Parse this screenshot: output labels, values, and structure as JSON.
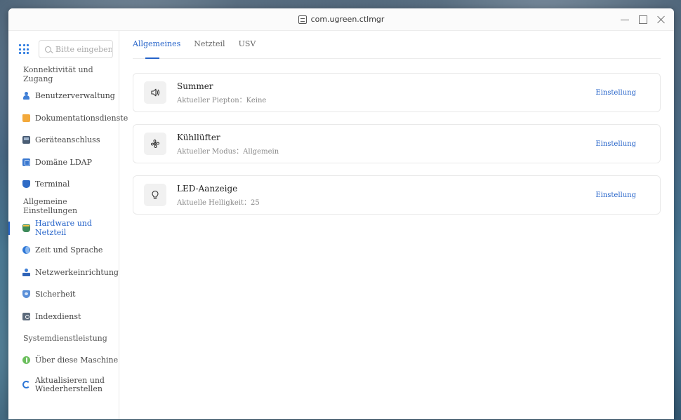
{
  "window": {
    "title": "com.ugreen.ctlmgr"
  },
  "search": {
    "placeholder": "Bitte eingeben"
  },
  "sidebar": {
    "groups": [
      {
        "label": "Konnektivität und Zugang",
        "items": [
          {
            "label": "Benutzerverwaltung",
            "icon": "user-icon"
          },
          {
            "label": "Dokumentationsdienste",
            "icon": "folder-icon"
          },
          {
            "label": "Geräteanschluss",
            "icon": "device-icon"
          },
          {
            "label": "Domäne LDAP",
            "icon": "domain-icon"
          },
          {
            "label": "Terminal",
            "icon": "terminal-icon"
          }
        ]
      },
      {
        "label": "Allgemeine Einstellungen",
        "items": [
          {
            "label": "Hardware und Netzteil",
            "icon": "hardware-icon",
            "active": true
          },
          {
            "label": "Zeit und Sprache",
            "icon": "globe-icon"
          },
          {
            "label": "Netzwerkeinrichtung",
            "icon": "network-icon"
          },
          {
            "label": "Sicherheit",
            "icon": "shield-icon"
          },
          {
            "label": "Indexdienst",
            "icon": "index-icon"
          }
        ]
      },
      {
        "label": "Systemdienstleistung",
        "items": [
          {
            "label": "Über diese Maschine",
            "icon": "info-icon"
          },
          {
            "label_line1": "Aktualisieren und",
            "label_line2": "Wiederherstellen",
            "icon": "refresh-icon"
          }
        ]
      }
    ]
  },
  "tabs": [
    {
      "label": "Allgemeines",
      "active": true
    },
    {
      "label": "Netzteil"
    },
    {
      "label": "USV"
    }
  ],
  "cards": [
    {
      "title": "Summer",
      "subtitle": "Aktueller Piepton：Keine",
      "action": "Einstellung",
      "icon": "speaker-icon",
      "glyph": "🔈"
    },
    {
      "title": "Kühllüfter",
      "subtitle": "Aktueller Modus：Allgemein",
      "action": "Einstellung",
      "icon": "fan-icon",
      "glyph": "✢"
    },
    {
      "title": "LED-Aanzeige",
      "subtitle": "Aktuelle Helligkeit：25",
      "action": "Einstellung",
      "icon": "bulb-icon",
      "glyph": "♁"
    }
  ],
  "colors": {
    "accent": "#2563c9"
  }
}
